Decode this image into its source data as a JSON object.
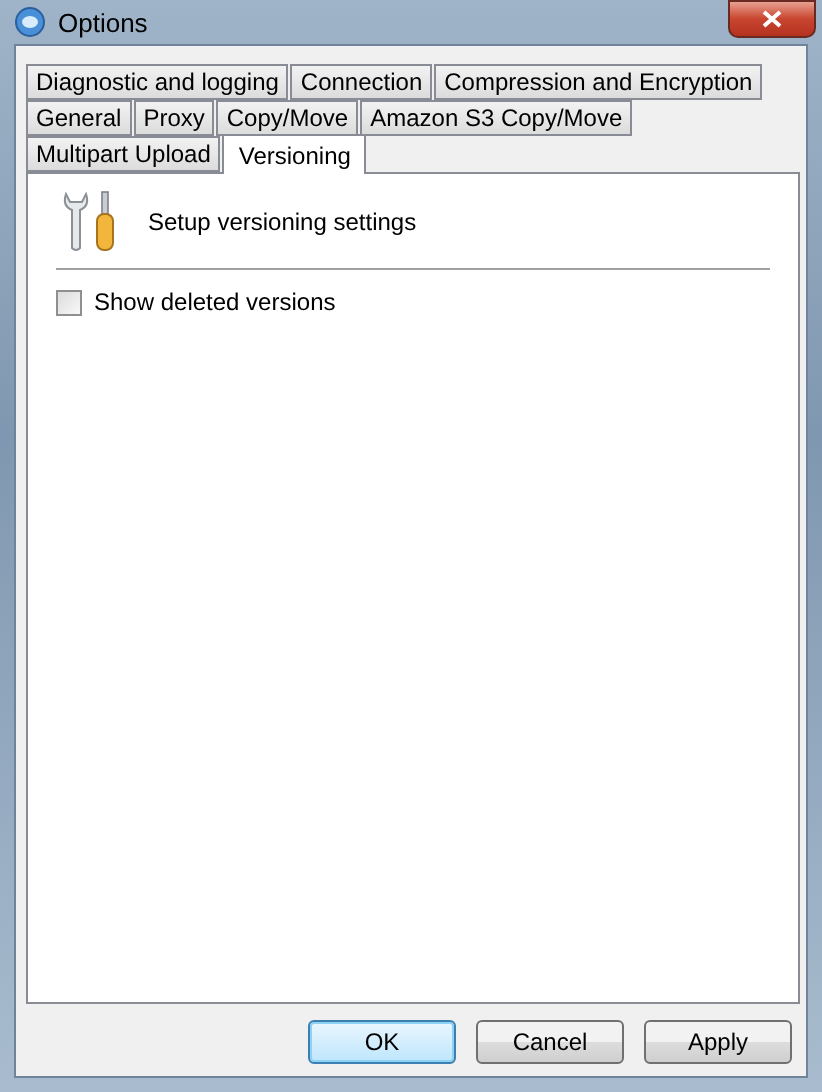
{
  "window": {
    "title": "Options"
  },
  "tab_rows": [
    [
      {
        "label": "Diagnostic and logging",
        "selected": false
      },
      {
        "label": "Connection",
        "selected": false
      },
      {
        "label": "Compression and Encryption",
        "selected": false
      }
    ],
    [
      {
        "label": "General",
        "selected": false
      },
      {
        "label": "Proxy",
        "selected": false
      },
      {
        "label": "Copy/Move",
        "selected": false
      },
      {
        "label": "Amazon S3 Copy/Move",
        "selected": false
      }
    ],
    [
      {
        "label": "Multipart Upload",
        "selected": false
      },
      {
        "label": "Versioning",
        "selected": true
      }
    ]
  ],
  "header": {
    "text": "Setup versioning settings"
  },
  "checkboxes": [
    {
      "label": "Show deleted versions",
      "checked": false
    }
  ],
  "buttons": [
    {
      "label": "OK",
      "kind": "default"
    },
    {
      "label": "Cancel",
      "kind": "normal"
    },
    {
      "label": "Apply",
      "kind": "normal"
    }
  ]
}
